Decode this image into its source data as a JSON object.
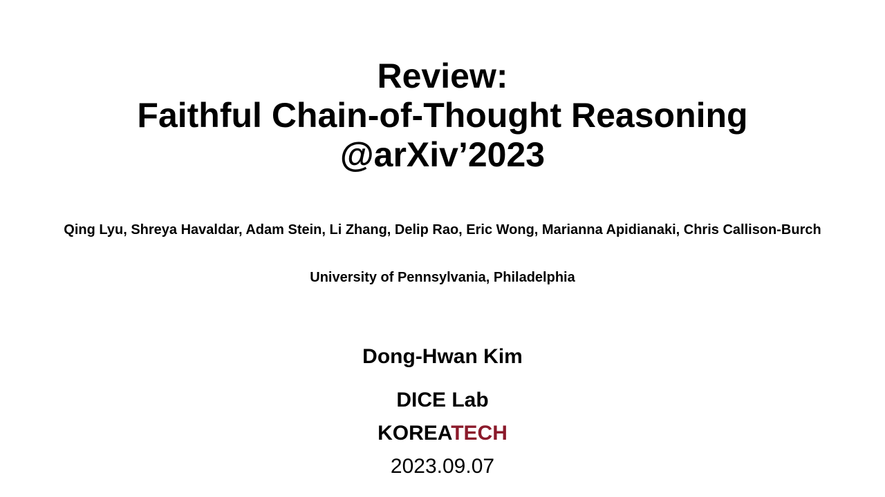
{
  "title": {
    "line1": "Review:",
    "line2": "Faithful Chain-of-Thought Reasoning",
    "line3": "@arXiv’2023"
  },
  "authors": "Qing Lyu, Shreya Havaldar, Adam Stein, Li Zhang, Delip Rao, Eric Wong, Marianna Apidianaki, Chris Callison-Burch",
  "affiliation": "University of Pennsylvania, Philadelphia",
  "presenter": {
    "name": "Dong-Hwan Kim",
    "lab": "DICE Lab",
    "school_part1": "KOREA",
    "school_part2": "TECH",
    "date": "2023.09.07"
  },
  "colors": {
    "accent": "#8b1a2b",
    "text": "#000000",
    "background": "#ffffff"
  }
}
